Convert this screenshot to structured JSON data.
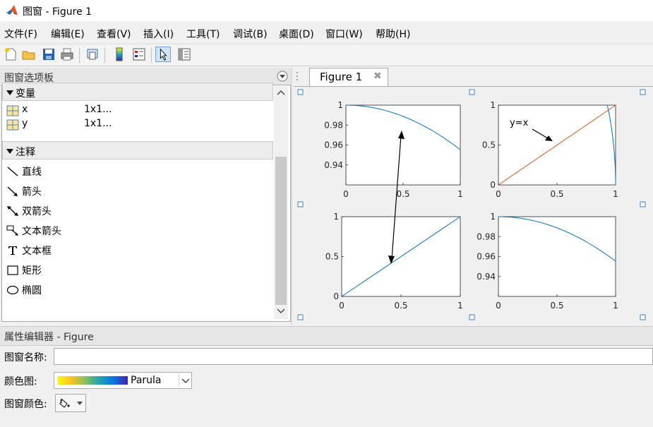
{
  "window": {
    "title": "图窗 - Figure 1"
  },
  "menu": [
    "文件(F)",
    "编辑(E)",
    "查看(V)",
    "插入(I)",
    "工具(T)",
    "调试(B)",
    "桌面(D)",
    "窗口(W)",
    "帮助(H)"
  ],
  "toolbar": {
    "buttons": [
      "new-file-icon",
      "open-folder-icon",
      "save-icon",
      "print-icon",
      "link-figure-icon",
      "colorbar-icon",
      "legend-icon",
      "select-pointer-icon",
      "property-editor-icon"
    ],
    "active": "select-pointer-icon"
  },
  "palette": {
    "title": "图窗选项板",
    "variables_header": "变量",
    "variables": [
      {
        "name": "x",
        "value": "1x1..."
      },
      {
        "name": "y",
        "value": "1x1..."
      }
    ],
    "annotations_header": "注释",
    "annotations": [
      "直线",
      "箭头",
      "双箭头",
      "文本箭头",
      "文本框",
      "矩形",
      "椭圆"
    ]
  },
  "figure_tab": {
    "label": "Figure 1",
    "close": "✖"
  },
  "chart_data": [
    {
      "type": "line",
      "position": "top-left",
      "series": [
        {
          "x": [
            0,
            0.2,
            0.4,
            0.6,
            0.8,
            1.0
          ],
          "y": [
            1.0,
            0.998,
            0.9921,
            0.9825,
            0.9697,
            0.954
          ]
        }
      ],
      "xlim": [
        0,
        1
      ],
      "ylim": [
        0.92,
        1.0
      ],
      "xticks": [
        "0",
        "0.5",
        "1"
      ],
      "yticks": [
        "0.94",
        "0.96",
        "0.98",
        "1"
      ],
      "color": "#0072bd"
    },
    {
      "type": "line",
      "position": "top-right",
      "series": [
        {
          "x": [
            0,
            1
          ],
          "y": [
            0,
            1
          ],
          "color": "#d95319"
        },
        {
          "x": [
            0.93,
            0.96,
            0.98,
            0.995,
            1.0
          ],
          "y": [
            1.0,
            0.6,
            0.4,
            0.2,
            0.0
          ],
          "color": "#0072bd"
        }
      ],
      "xlim": [
        0,
        1
      ],
      "ylim": [
        0,
        1
      ],
      "xticks": [
        "0",
        "0.5",
        "1"
      ],
      "yticks": [
        "0",
        "0.5",
        "1"
      ],
      "annotation": {
        "text": "y=x"
      }
    },
    {
      "type": "line",
      "position": "bottom-left",
      "series": [
        {
          "x": [
            0,
            1
          ],
          "y": [
            0,
            1
          ],
          "color": "#0072bd"
        }
      ],
      "xlim": [
        0,
        1
      ],
      "ylim": [
        0,
        1
      ],
      "xticks": [
        "0",
        "0.5",
        "1"
      ],
      "yticks": [
        "0",
        "0.5",
        "1"
      ]
    },
    {
      "type": "line",
      "position": "bottom-right",
      "series": [
        {
          "x": [
            0,
            0.2,
            0.4,
            0.6,
            0.8,
            1.0
          ],
          "y": [
            1.0,
            0.998,
            0.9921,
            0.9825,
            0.9697,
            0.954
          ],
          "color": "#0072bd"
        }
      ],
      "xlim": [
        0,
        1
      ],
      "ylim": [
        0.92,
        1.0
      ],
      "xticks": [
        "0",
        "0.5",
        "1"
      ],
      "yticks": [
        "0.94",
        "0.96",
        "0.98",
        "1"
      ]
    }
  ],
  "property_editor": {
    "title": "属性编辑器 - Figure",
    "name_label": "图窗名称:",
    "name_value": "",
    "colormap_label": "颜色图:",
    "colormap_value": "Parula",
    "color_label": "图窗颜色:"
  }
}
